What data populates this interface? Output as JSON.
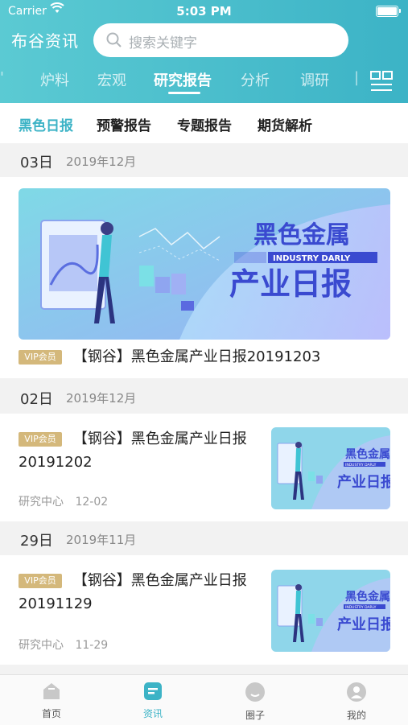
{
  "status_bar": {
    "carrier": "Carrier",
    "time": "5:03 PM"
  },
  "header": {
    "brand": "布谷资讯",
    "search_placeholder": "搜索关键字",
    "tabs": [
      {
        "label": "炉料"
      },
      {
        "label": "宏观"
      },
      {
        "label": "研究报告",
        "active": true
      },
      {
        "label": "分析"
      },
      {
        "label": "调研"
      }
    ]
  },
  "sub_tabs": [
    {
      "label": "黑色日报",
      "active": true
    },
    {
      "label": "预警报告"
    },
    {
      "label": "专题报告"
    },
    {
      "label": "期货解析"
    }
  ],
  "sections": [
    {
      "day": "03日",
      "month": "2019年12月",
      "article": {
        "badge": "VIP会员",
        "title": "【钢谷】黑色金属产业日报20191203",
        "banner": {
          "title": "黑色金属",
          "subtitle": "INDUSTRY DARLY",
          "title2": "产业日报"
        }
      }
    },
    {
      "day": "02日",
      "month": "2019年12月",
      "article": {
        "badge": "VIP会员",
        "title_line1": "【钢谷】黑色金属产业日报",
        "title_line2": "20191202",
        "source": "研究中心",
        "date": "12-02",
        "thumb": {
          "title": "黑色金属",
          "subtitle": "INDUSTRY DARLY",
          "title2": "产业日报"
        }
      }
    },
    {
      "day": "29日",
      "month": "2019年11月",
      "article": {
        "badge": "VIP会员",
        "title_line1": "【钢谷】黑色金属产业日报",
        "title_line2": "20191129",
        "source": "研究中心",
        "date": "11-29",
        "thumb": {
          "title": "黑色金属",
          "subtitle": "INDUSTRY DARLY",
          "title2": "产业日报"
        }
      }
    }
  ],
  "tab_bar": [
    {
      "label": "首页",
      "icon": "home-icon"
    },
    {
      "label": "资讯",
      "icon": "news-icon",
      "active": true
    },
    {
      "label": "圈子",
      "icon": "circle-icon"
    },
    {
      "label": "我的",
      "icon": "profile-icon"
    }
  ],
  "colors": {
    "accent": "#3cb3c6",
    "vip": "#d4b87b",
    "banner_text": "#3a4ad0"
  }
}
